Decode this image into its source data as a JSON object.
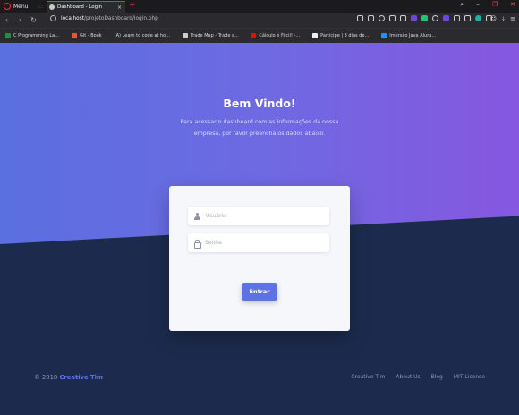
{
  "browser": {
    "menu_label": "Menu",
    "tab_title": "Dashboard - Login",
    "tab_close": "×",
    "new_tab": "+",
    "url_host": "localhost",
    "url_path": "/projetoDashboard/login.php",
    "nav": {
      "back": "‹",
      "forward": "›",
      "reload": "↻"
    },
    "window": {
      "minimize": "–",
      "restore": "❐",
      "close": "✕"
    },
    "bookmarks": [
      {
        "label": "C Programming La...",
        "color": "#2b8a3e"
      },
      {
        "label": "Git - Book",
        "color": "#f05033"
      },
      {
        "label": "(A)  Learn to code at ho...",
        "color": "#444444"
      },
      {
        "label": "Trade Map - Trade s...",
        "color": "#cccccc"
      },
      {
        "label": "Cálculo é Fácil! -...",
        "color": "#ff0000"
      },
      {
        "label": "Participe | 3 dias de...",
        "color": "#eeeeee"
      },
      {
        "label": "Imersão Java Alura...",
        "color": "#1e90ff"
      }
    ]
  },
  "hero": {
    "title": "Bem Vindo!",
    "text": "Para acessar o dashboard com as informações da nossa empresa, por favor preencha os dados abaixo."
  },
  "login": {
    "username_placeholder": "Usuário",
    "password_placeholder": "Senha",
    "submit_label": "Entrar"
  },
  "footer": {
    "copyright": "© 2018",
    "brand": "Creative Tim",
    "links": [
      "Creative Tim",
      "About Us",
      "Blog",
      "MIT License"
    ]
  },
  "colors": {
    "accent": "#5e72e4",
    "hero_start": "#5a6fe0",
    "hero_end": "#8657e0",
    "background": "#1c2b4d"
  }
}
